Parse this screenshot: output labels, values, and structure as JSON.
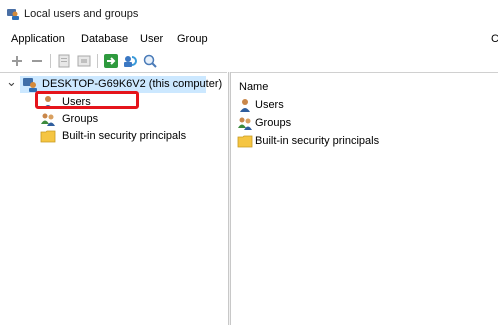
{
  "window": {
    "title": "Local users and groups",
    "icon": "users-app-icon"
  },
  "menu": [
    "Application",
    "Database",
    "User",
    "Group"
  ],
  "toolbar": {
    "buttons": [
      "add-icon",
      "remove-icon",
      "properties-icon",
      "edit-icon",
      "export-icon",
      "refresh-icon",
      "search-icon"
    ]
  },
  "tree": {
    "expand_glyph": "⌄",
    "root": {
      "label": "DESKTOP-G69K6V2 (this computer)",
      "icon": "computer-users-icon",
      "selected": true
    },
    "children": [
      {
        "label": "Users",
        "icon": "user-icon"
      },
      {
        "label": "Groups",
        "icon": "groups-icon"
      },
      {
        "label": "Built-in security principals",
        "icon": "folder-icon"
      }
    ]
  },
  "list": {
    "column_header": "Name",
    "rows": [
      {
        "label": "Users",
        "icon": "user-icon"
      },
      {
        "label": "Groups",
        "icon": "groups-icon"
      },
      {
        "label": "Built-in security principals",
        "icon": "folder-icon"
      }
    ]
  },
  "colors": {
    "selection": "#cce8ff",
    "annotation": "#e5141b",
    "folder": "#f5c542"
  },
  "partial_text": {
    "right_edge": "C"
  }
}
